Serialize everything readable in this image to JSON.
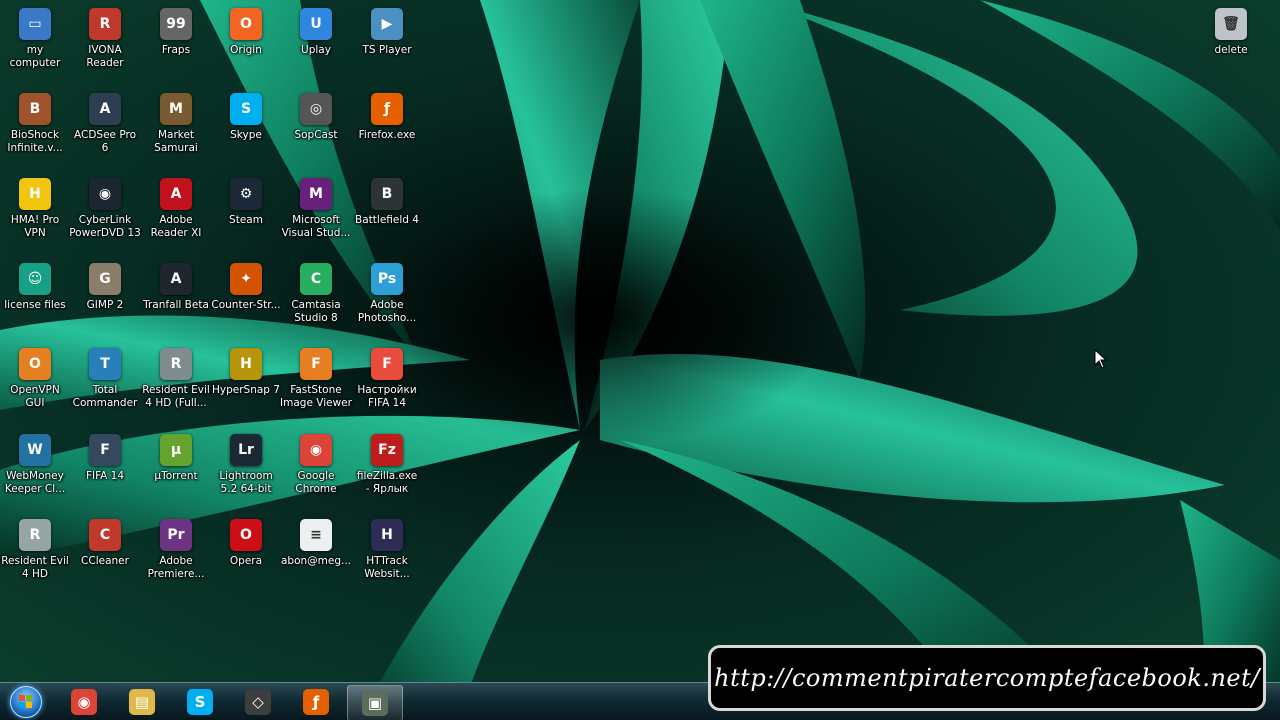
{
  "desktop": {
    "icons": [
      {
        "label": "my\ncomputer",
        "icon": "computer-icon",
        "color": "#3a78c8",
        "glyph": "▭"
      },
      {
        "label": "IVONA\nReader",
        "icon": "ivona-reader-icon",
        "color": "#c0392b",
        "glyph": "R"
      },
      {
        "label": "Fraps",
        "icon": "fraps-icon",
        "color": "#666666",
        "glyph": "99"
      },
      {
        "label": "Origin",
        "icon": "origin-icon",
        "color": "#f26522",
        "glyph": "O"
      },
      {
        "label": "Uplay",
        "icon": "uplay-icon",
        "color": "#2e86de",
        "glyph": "U"
      },
      {
        "label": "TS Player",
        "icon": "ts-player-icon",
        "color": "#4a90c2",
        "glyph": "▶"
      },
      {
        "label": "BioShock\nInfinite.v...",
        "icon": "bioshock-icon",
        "color": "#a0522d",
        "glyph": "B"
      },
      {
        "label": "ACDSee Pro\n6",
        "icon": "acdsee-icon",
        "color": "#2c3e50",
        "glyph": "A"
      },
      {
        "label": "Market\nSamurai",
        "icon": "market-samurai-icon",
        "color": "#7a5a2e",
        "glyph": "M"
      },
      {
        "label": "Skype",
        "icon": "skype-icon",
        "color": "#00aff0",
        "glyph": "S"
      },
      {
        "label": "SopCast",
        "icon": "sopcast-icon",
        "color": "#555555",
        "glyph": "◎"
      },
      {
        "label": "Firefox.exe",
        "icon": "firefox-icon",
        "color": "#e66000",
        "glyph": "ƒ"
      },
      {
        "label": "HMA! Pro\nVPN",
        "icon": "hma-vpn-icon",
        "color": "#f1c40f",
        "glyph": "H"
      },
      {
        "label": "CyberLink\nPowerDVD 13",
        "icon": "powerdvd-icon",
        "color": "#1b2631",
        "glyph": "◉"
      },
      {
        "label": "Adobe\nReader XI",
        "icon": "adobe-reader-icon",
        "color": "#c0121c",
        "glyph": "A"
      },
      {
        "label": "Steam",
        "icon": "steam-icon",
        "color": "#1b2838",
        "glyph": "⚙"
      },
      {
        "label": "Microsoft\nVisual Stud...",
        "icon": "visual-studio-icon",
        "color": "#68217a",
        "glyph": "M"
      },
      {
        "label": "Battlefield 4",
        "icon": "battlefield-icon",
        "color": "#2d3436",
        "glyph": "B"
      },
      {
        "label": "license files",
        "icon": "license-files-icon",
        "color": "#16a085",
        "glyph": "☺"
      },
      {
        "label": "GIMP 2",
        "icon": "gimp-icon",
        "color": "#8a7d6a",
        "glyph": "G"
      },
      {
        "label": "Tranfall Beta",
        "icon": "tranfall-icon",
        "color": "#1e272e",
        "glyph": "A"
      },
      {
        "label": "Counter-Str...",
        "icon": "counter-strike-icon",
        "color": "#d35400",
        "glyph": "✦"
      },
      {
        "label": "Camtasia\nStudio 8",
        "icon": "camtasia-icon",
        "color": "#27ae60",
        "glyph": "C"
      },
      {
        "label": "Adobe\nPhotosho...",
        "icon": "photoshop-icon",
        "color": "#2b9fd6",
        "glyph": "Ps"
      },
      {
        "label": "OpenVPN\nGUI",
        "icon": "openvpn-icon",
        "color": "#e67e22",
        "glyph": "O"
      },
      {
        "label": "Total\nCommander",
        "icon": "total-commander-icon",
        "color": "#2980b9",
        "glyph": "T"
      },
      {
        "label": "Resident Evil\n4 HD (Full...",
        "icon": "resident-evil-icon",
        "color": "#7f8c8d",
        "glyph": "R"
      },
      {
        "label": "HyperSnap 7",
        "icon": "hypersnap-icon",
        "color": "#b7950b",
        "glyph": "H"
      },
      {
        "label": "FastStone\nImage Viewer",
        "icon": "faststone-icon",
        "color": "#e67e22",
        "glyph": "F"
      },
      {
        "label": "Настройки\nFIFA 14",
        "icon": "fifa-settings-icon",
        "color": "#e74c3c",
        "glyph": "F"
      },
      {
        "label": "WebMoney\nKeeper Cl...",
        "icon": "webmoney-icon",
        "color": "#2471a3",
        "glyph": "W"
      },
      {
        "label": "FIFA 14",
        "icon": "fifa-icon",
        "color": "#34495e",
        "glyph": "F"
      },
      {
        "label": "µTorrent",
        "icon": "utorrent-icon",
        "color": "#66a32e",
        "glyph": "µ"
      },
      {
        "label": "Lightroom\n5.2 64-bit",
        "icon": "lightroom-icon",
        "color": "#1c2833",
        "glyph": "Lr"
      },
      {
        "label": "Google\nChrome",
        "icon": "chrome-icon",
        "color": "#db4437",
        "glyph": "◉"
      },
      {
        "label": "fileZilla.exe\n- Ярлык",
        "icon": "filezilla-icon",
        "color": "#bf1d1d",
        "glyph": "Fz"
      },
      {
        "label": "Resident Evil\n4 HD",
        "icon": "resident-evil-hd-icon",
        "color": "#95a5a6",
        "glyph": "R"
      },
      {
        "label": "CCleaner",
        "icon": "ccleaner-icon",
        "color": "#c0392b",
        "glyph": "C"
      },
      {
        "label": "Adobe\nPremiere...",
        "icon": "premiere-icon",
        "color": "#6c3483",
        "glyph": "Pr"
      },
      {
        "label": "Opera",
        "icon": "opera-icon",
        "color": "#cc0f16",
        "glyph": "O"
      },
      {
        "label": "abon@meg...",
        "icon": "text-file-icon",
        "color": "#ecf0f1",
        "glyph": "≡"
      },
      {
        "label": "HTTrack\nWebsit...",
        "icon": "httrack-icon",
        "color": "#2c2c54",
        "glyph": "H"
      },
      {
        "label": "delete",
        "icon": "recycle-bin-icon",
        "color": "#bdc3c7",
        "glyph": "🗑"
      }
    ]
  },
  "taskbar": {
    "buttons": [
      {
        "icon": "chrome-taskbar-icon",
        "color": "#db4437",
        "glyph": "◉"
      },
      {
        "icon": "explorer-taskbar-icon",
        "color": "#e0b84a",
        "glyph": "▤"
      },
      {
        "icon": "skype-taskbar-icon",
        "color": "#00aff0",
        "glyph": "S"
      },
      {
        "icon": "app-taskbar-icon",
        "color": "#3d3d3d",
        "glyph": "◇"
      },
      {
        "icon": "firefox-taskbar-icon",
        "color": "#e66000",
        "glyph": "ƒ"
      },
      {
        "icon": "camtasia-taskbar-icon",
        "color": "#5d6d5d",
        "glyph": "▣"
      }
    ]
  },
  "banner": {
    "url": "http://commentpiratercomptefacebook.net/"
  }
}
